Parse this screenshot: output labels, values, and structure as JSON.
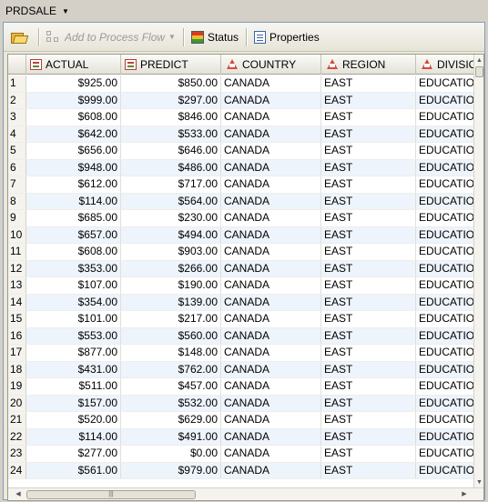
{
  "tab": {
    "title": "PRDSALE"
  },
  "toolbar": {
    "add_to_flow_label": "Add to Process Flow",
    "status_label": "Status",
    "properties_label": "Properties"
  },
  "table": {
    "columns": [
      "ACTUAL",
      "PREDICT",
      "COUNTRY",
      "REGION",
      "DIVISION"
    ],
    "column_types": [
      "numeric",
      "numeric",
      "character",
      "character",
      "character"
    ],
    "rows": [
      [
        "1",
        "$925.00",
        "$850.00",
        "CANADA",
        "EAST",
        "EDUCATIO"
      ],
      [
        "2",
        "$999.00",
        "$297.00",
        "CANADA",
        "EAST",
        "EDUCATIO"
      ],
      [
        "3",
        "$608.00",
        "$846.00",
        "CANADA",
        "EAST",
        "EDUCATIO"
      ],
      [
        "4",
        "$642.00",
        "$533.00",
        "CANADA",
        "EAST",
        "EDUCATIO"
      ],
      [
        "5",
        "$656.00",
        "$646.00",
        "CANADA",
        "EAST",
        "EDUCATIO"
      ],
      [
        "6",
        "$948.00",
        "$486.00",
        "CANADA",
        "EAST",
        "EDUCATIO"
      ],
      [
        "7",
        "$612.00",
        "$717.00",
        "CANADA",
        "EAST",
        "EDUCATIO"
      ],
      [
        "8",
        "$114.00",
        "$564.00",
        "CANADA",
        "EAST",
        "EDUCATIO"
      ],
      [
        "9",
        "$685.00",
        "$230.00",
        "CANADA",
        "EAST",
        "EDUCATIO"
      ],
      [
        "10",
        "$657.00",
        "$494.00",
        "CANADA",
        "EAST",
        "EDUCATIO"
      ],
      [
        "11",
        "$608.00",
        "$903.00",
        "CANADA",
        "EAST",
        "EDUCATIO"
      ],
      [
        "12",
        "$353.00",
        "$266.00",
        "CANADA",
        "EAST",
        "EDUCATIO"
      ],
      [
        "13",
        "$107.00",
        "$190.00",
        "CANADA",
        "EAST",
        "EDUCATIO"
      ],
      [
        "14",
        "$354.00",
        "$139.00",
        "CANADA",
        "EAST",
        "EDUCATIO"
      ],
      [
        "15",
        "$101.00",
        "$217.00",
        "CANADA",
        "EAST",
        "EDUCATIO"
      ],
      [
        "16",
        "$553.00",
        "$560.00",
        "CANADA",
        "EAST",
        "EDUCATIO"
      ],
      [
        "17",
        "$877.00",
        "$148.00",
        "CANADA",
        "EAST",
        "EDUCATIO"
      ],
      [
        "18",
        "$431.00",
        "$762.00",
        "CANADA",
        "EAST",
        "EDUCATIO"
      ],
      [
        "19",
        "$511.00",
        "$457.00",
        "CANADA",
        "EAST",
        "EDUCATIO"
      ],
      [
        "20",
        "$157.00",
        "$532.00",
        "CANADA",
        "EAST",
        "EDUCATIO"
      ],
      [
        "21",
        "$520.00",
        "$629.00",
        "CANADA",
        "EAST",
        "EDUCATIO"
      ],
      [
        "22",
        "$114.00",
        "$491.00",
        "CANADA",
        "EAST",
        "EDUCATIO"
      ],
      [
        "23",
        "$277.00",
        "$0.00",
        "CANADA",
        "EAST",
        "EDUCATIO"
      ],
      [
        "24",
        "$561.00",
        "$979.00",
        "CANADA",
        "EAST",
        "EDUCATIO"
      ]
    ]
  }
}
